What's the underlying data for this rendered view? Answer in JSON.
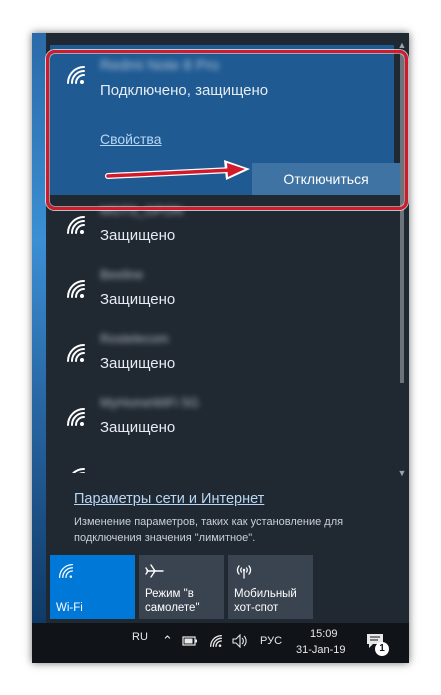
{
  "connected": {
    "name": "Redmi Note 8 Pro",
    "status": "Подключено, защищено",
    "properties_label": "Свойства",
    "disconnect_label": "Отключиться"
  },
  "networks": [
    {
      "name": "MGTS_GPON",
      "status": "Защищено"
    },
    {
      "name": "Beeline",
      "status": "Защищено"
    },
    {
      "name": "Rostelecom",
      "status": "Защищено"
    },
    {
      "name": "MyHomeWiFi 5G",
      "status": "Защищено"
    }
  ],
  "settings": {
    "link": "Параметры сети и Интернет",
    "description": "Изменение параметров, таких как установление для подключения значения \"лимитное\"."
  },
  "tiles": {
    "wifi": "Wi-Fi",
    "airplane_line1": "Режим \"в",
    "airplane_line2": "самолете\"",
    "hotspot_line1": "Мобильный",
    "hotspot_line2": "хот-спот"
  },
  "taskbar": {
    "lang_short": "RU",
    "lang_full": "РУС",
    "time": "15:09",
    "date": "31-Jan-19",
    "notifications": "1"
  },
  "colors": {
    "accent": "#1f5a92",
    "tile_active": "#0078d7",
    "tile_inactive": "#3a4350",
    "highlight": "#d21a2a"
  }
}
